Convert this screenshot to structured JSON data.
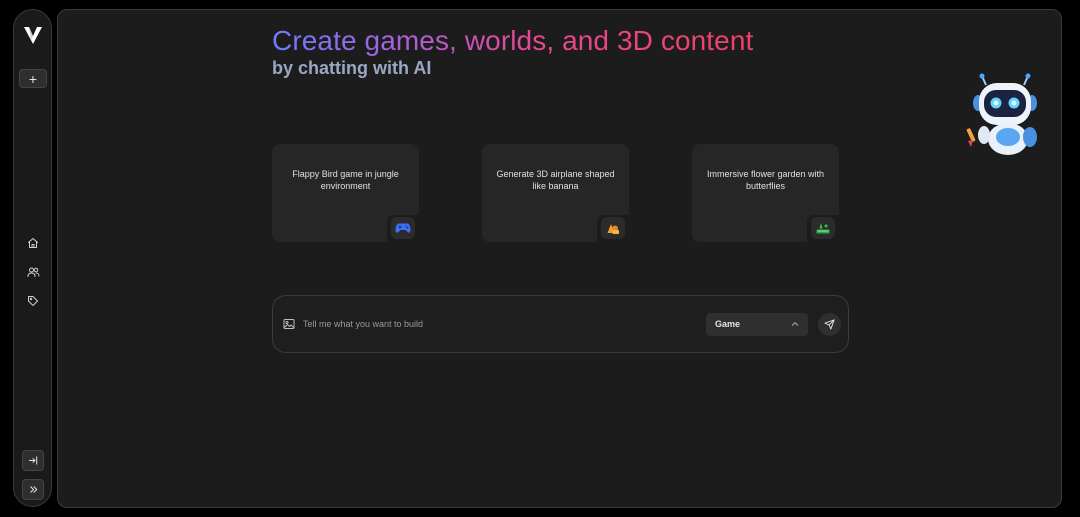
{
  "sidebar": {
    "logo_icon": "v-logo-icon",
    "new_button": {
      "label": "+",
      "icon": "plus-icon"
    },
    "nav": [
      {
        "id": "home",
        "icon": "home-icon"
      },
      {
        "id": "community",
        "icon": "users-icon"
      },
      {
        "id": "pricing",
        "icon": "tag-icon"
      }
    ],
    "bottom": [
      {
        "id": "login",
        "icon": "login-icon"
      },
      {
        "id": "expand",
        "icon": "chevrons-right-icon"
      }
    ]
  },
  "hero": {
    "title": "Create games, worlds, and 3D content",
    "subtitle": "by chatting with AI",
    "gradient": [
      "#6b7cff",
      "#b05cd6",
      "#e8488f",
      "#ef4068"
    ],
    "subtitle_color": "#9aa6c2"
  },
  "suggestions": [
    {
      "text": "Flappy Bird game in jungle environment",
      "icon": "gamepad-icon",
      "icon_color": "#3b6ff5"
    },
    {
      "text": "Generate 3D airplane shaped like banana",
      "icon": "shapes-icon",
      "icon_color": "#f0a030"
    },
    {
      "text": "Immersive flower garden with butterflies",
      "icon": "world-icon",
      "icon_color": "#32c850"
    }
  ],
  "prompt": {
    "placeholder": "Tell me what you want to build",
    "value": "",
    "image_icon": "image-icon",
    "mode": "Game",
    "send_icon": "send-icon"
  },
  "mascot": {
    "icon": "robot-mascot-icon"
  },
  "colors": {
    "background": "#000000",
    "panel": "#1c1c1c",
    "card": "#262626",
    "border": "#3a3a3a",
    "text": "#e5e5e5"
  }
}
